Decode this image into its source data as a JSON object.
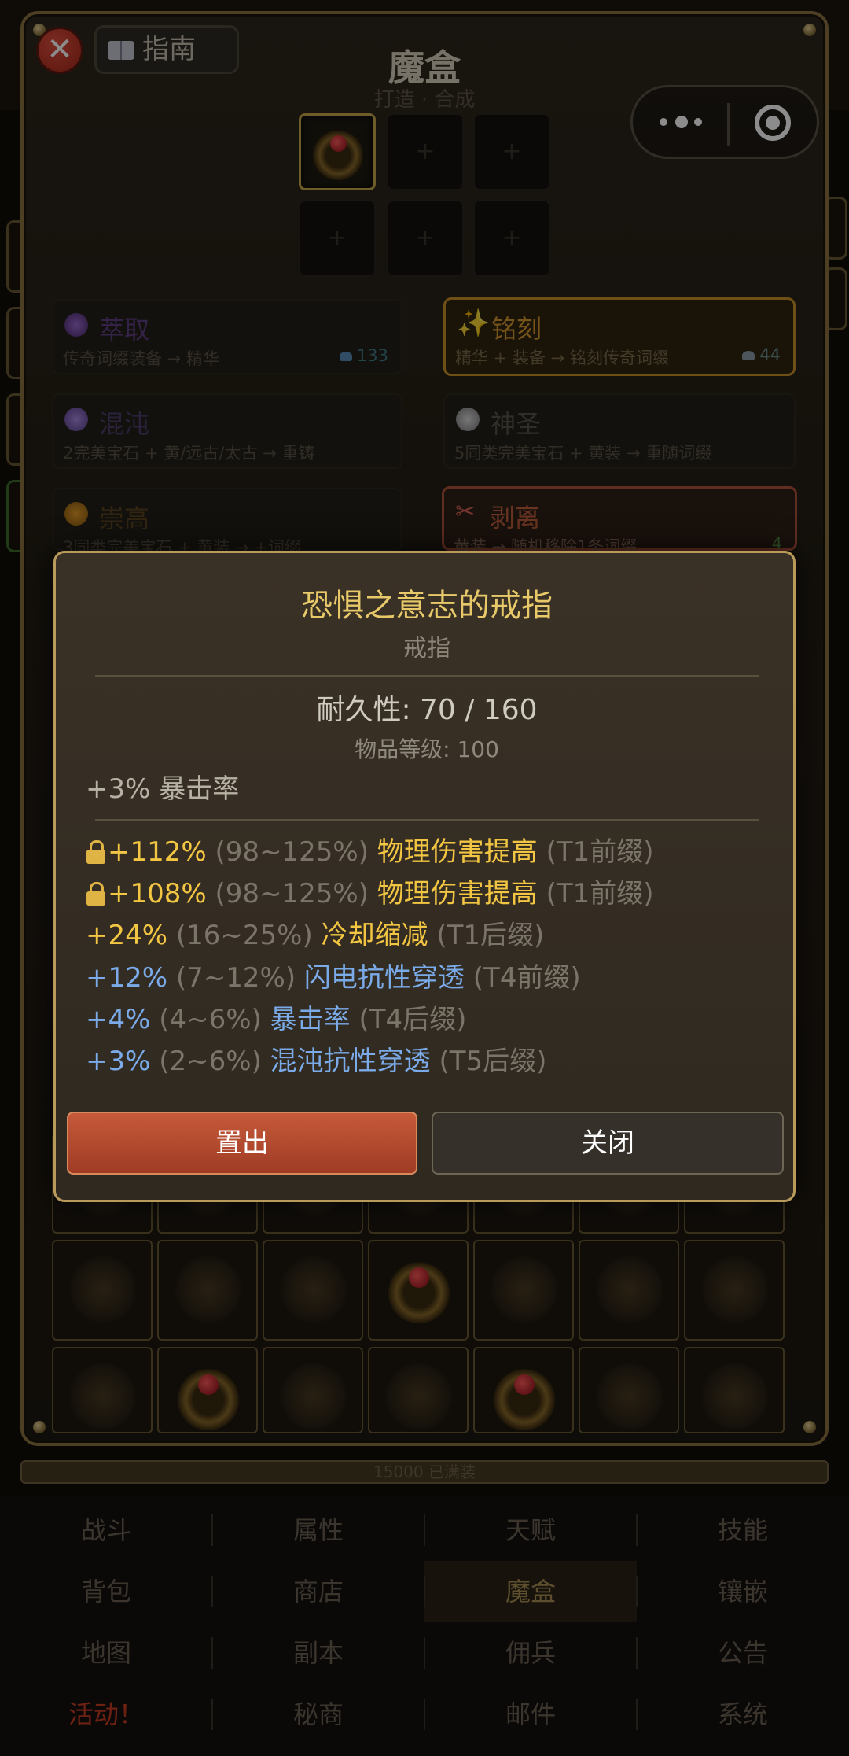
{
  "header": {
    "close_symbol": "✕",
    "guide_label": "指南",
    "title": "魔盒",
    "subtitle": "打造 · 合成"
  },
  "recipes": [
    {
      "name": "萃取",
      "desc": "传奇词缀装备 → 精华",
      "cost": "133",
      "icon_color": "#6b3aa0",
      "name_color": "#5f3f86",
      "state": "normal"
    },
    {
      "name": "铭刻",
      "desc": "精华 + 装备 → 铭刻传奇词缀",
      "cost": "44",
      "icon": "sparkle-icon",
      "name_color": "#d8982e",
      "state": "selected"
    },
    {
      "name": "混沌",
      "desc": "2完美宝石 + 黄/远古/太古 → 重铸",
      "icon_color": "#8a6ad0",
      "name_color": "#4e3c6a",
      "state": "normal"
    },
    {
      "name": "神圣",
      "desc": "5同类完美宝石 + 黄装 → 重随词缀",
      "icon_color": "#c8c8c8",
      "name_color": "#5a554c",
      "state": "normal"
    },
    {
      "name": "崇高",
      "desc": "3同类完美宝石 + 黄装 → +词缀",
      "icon_color": "#d08a1a",
      "name_color": "#5a4420",
      "state": "normal"
    },
    {
      "name": "剥离",
      "desc": "黄装 → 随机移除1条词缀",
      "cost": "4",
      "icon": "scissors-icon",
      "name_color": "#c0603c",
      "state": "active"
    }
  ],
  "tooltip": {
    "item_name": "恐惧之意志的戒指",
    "item_type": "戒指",
    "durability": "耐久性: 70 / 160",
    "item_level": "物品等级: 100",
    "implicit": "+3% 暴击率",
    "affixes": [
      {
        "locked": true,
        "value": "+112%",
        "range": "(98~125%)",
        "name": "物理伤害提高",
        "tier": "(T1前缀)",
        "color": "gold"
      },
      {
        "locked": true,
        "value": "+108%",
        "range": "(98~125%)",
        "name": "物理伤害提高",
        "tier": "(T1前缀)",
        "color": "gold"
      },
      {
        "locked": false,
        "value": "+24%",
        "range": "(16~25%)",
        "name": "冷却缩减",
        "tier": "(T1后缀)",
        "color": "gold"
      },
      {
        "locked": false,
        "value": "+12%",
        "range": "(7~12%)",
        "name": "闪电抗性穿透",
        "tier": "(T4前缀)",
        "color": "blue"
      },
      {
        "locked": false,
        "value": "+4%",
        "range": "(4~6%)",
        "name": "暴击率",
        "tier": "(T4后缀)",
        "color": "blue"
      },
      {
        "locked": false,
        "value": "+3%",
        "range": "(2~6%)",
        "name": "混沌抗性穿透",
        "tier": "(T5后缀)",
        "color": "blue"
      }
    ],
    "btn_out": "置出",
    "btn_close": "关闭"
  },
  "progress_text": "15000 已满装",
  "nav": [
    [
      "战斗",
      "属性",
      "天赋",
      "技能"
    ],
    [
      "背包",
      "商店",
      "魔盒",
      "镶嵌"
    ],
    [
      "地图",
      "副本",
      "佣兵",
      "公告"
    ],
    [
      "活动！",
      "秘商",
      "邮件",
      "系统"
    ]
  ],
  "nav_active": "魔盒",
  "slot_plus": "+"
}
